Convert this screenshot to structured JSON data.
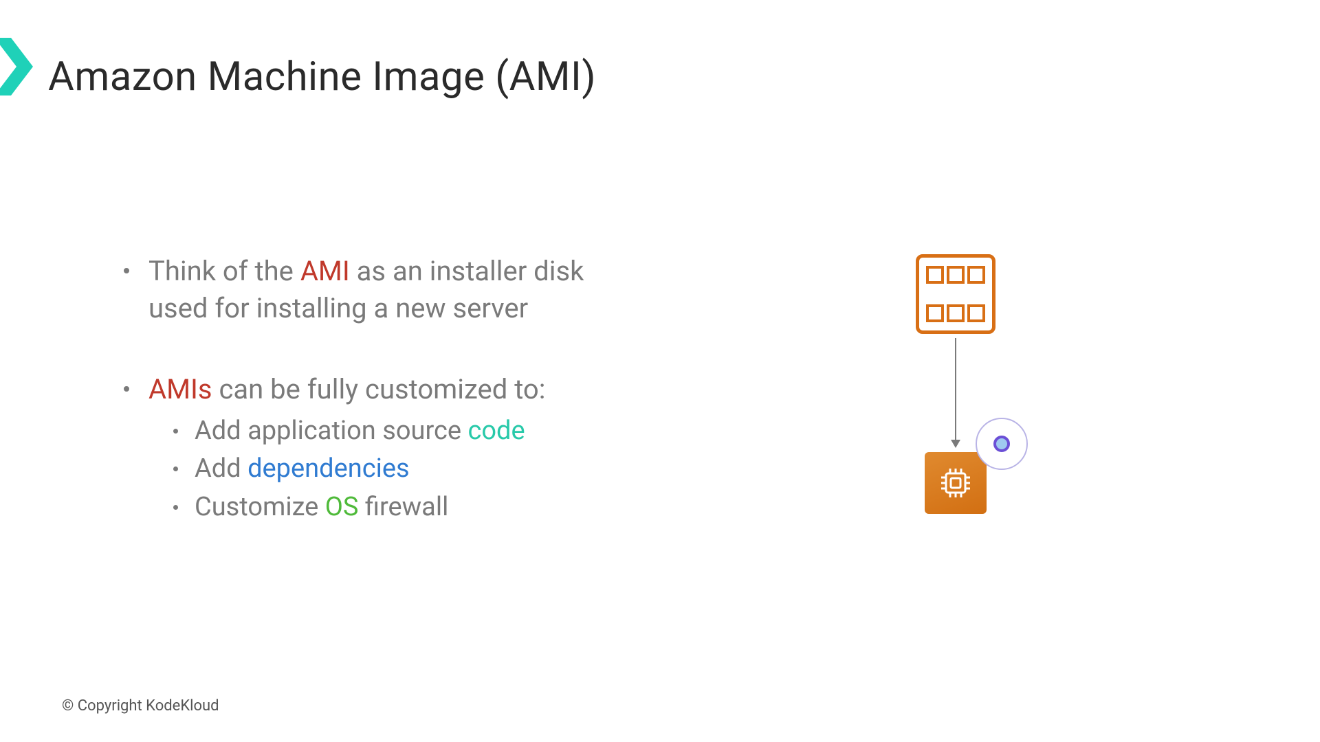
{
  "title": "Amazon Machine Image (AMI)",
  "bullets": {
    "b1_pre": "Think of the ",
    "b1_hl": "AMI",
    "b1_post": " as an installer disk used for installing a new server",
    "b2_hl": "AMIs",
    "b2_post": " can be fully customized to:",
    "s1_pre": "Add application source ",
    "s1_hl": "code",
    "s2_pre": "Add ",
    "s2_hl": "dependencies",
    "s3_pre": "Customize ",
    "s3_hl": "OS",
    "s3_post": " firewall"
  },
  "copyright": "© Copyright KodeKloud"
}
